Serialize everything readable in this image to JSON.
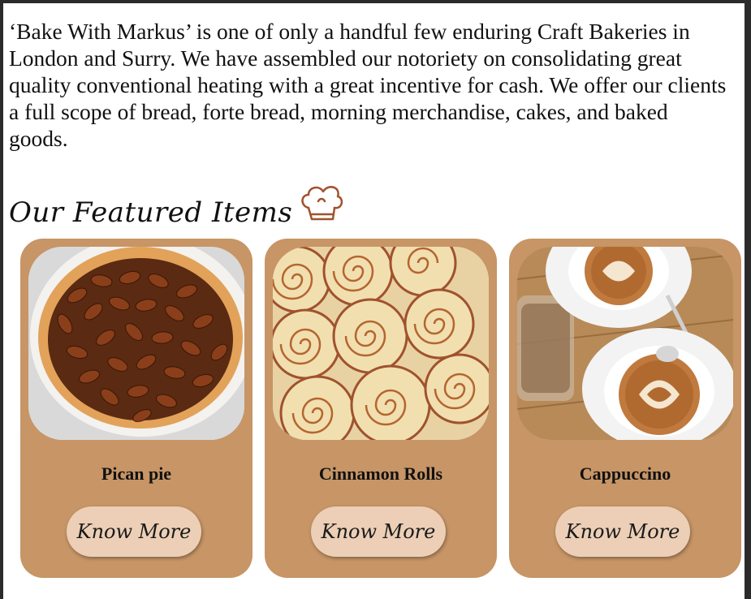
{
  "intro": {
    "text": "‘Bake With Markus’ is one of only a handful few enduring Craft Bakeries in London and Surry. We have assembled our notoriety on consolidating great quality conventional heating with a great incentive for cash. We offer our clients a full scope of bread, forte bread, morning merchandise, cakes, and baked goods."
  },
  "featured": {
    "title": "Our Featured Items",
    "icon": "chef-hat-icon"
  },
  "items": [
    {
      "name": "Pican pie",
      "button_label": "Know More",
      "image": "pecan-pie-photo"
    },
    {
      "name": "Cinnamon Rolls",
      "button_label": "Know More",
      "image": "cinnamon-rolls-photo"
    },
    {
      "name": "Cappuccino",
      "button_label": "Know More",
      "image": "cappuccino-photo"
    }
  ],
  "colors": {
    "card_background": "#c79566",
    "button_background": "#eccfb6",
    "icon_color": "#a0522d",
    "window_frame": "#2b2b2b"
  }
}
